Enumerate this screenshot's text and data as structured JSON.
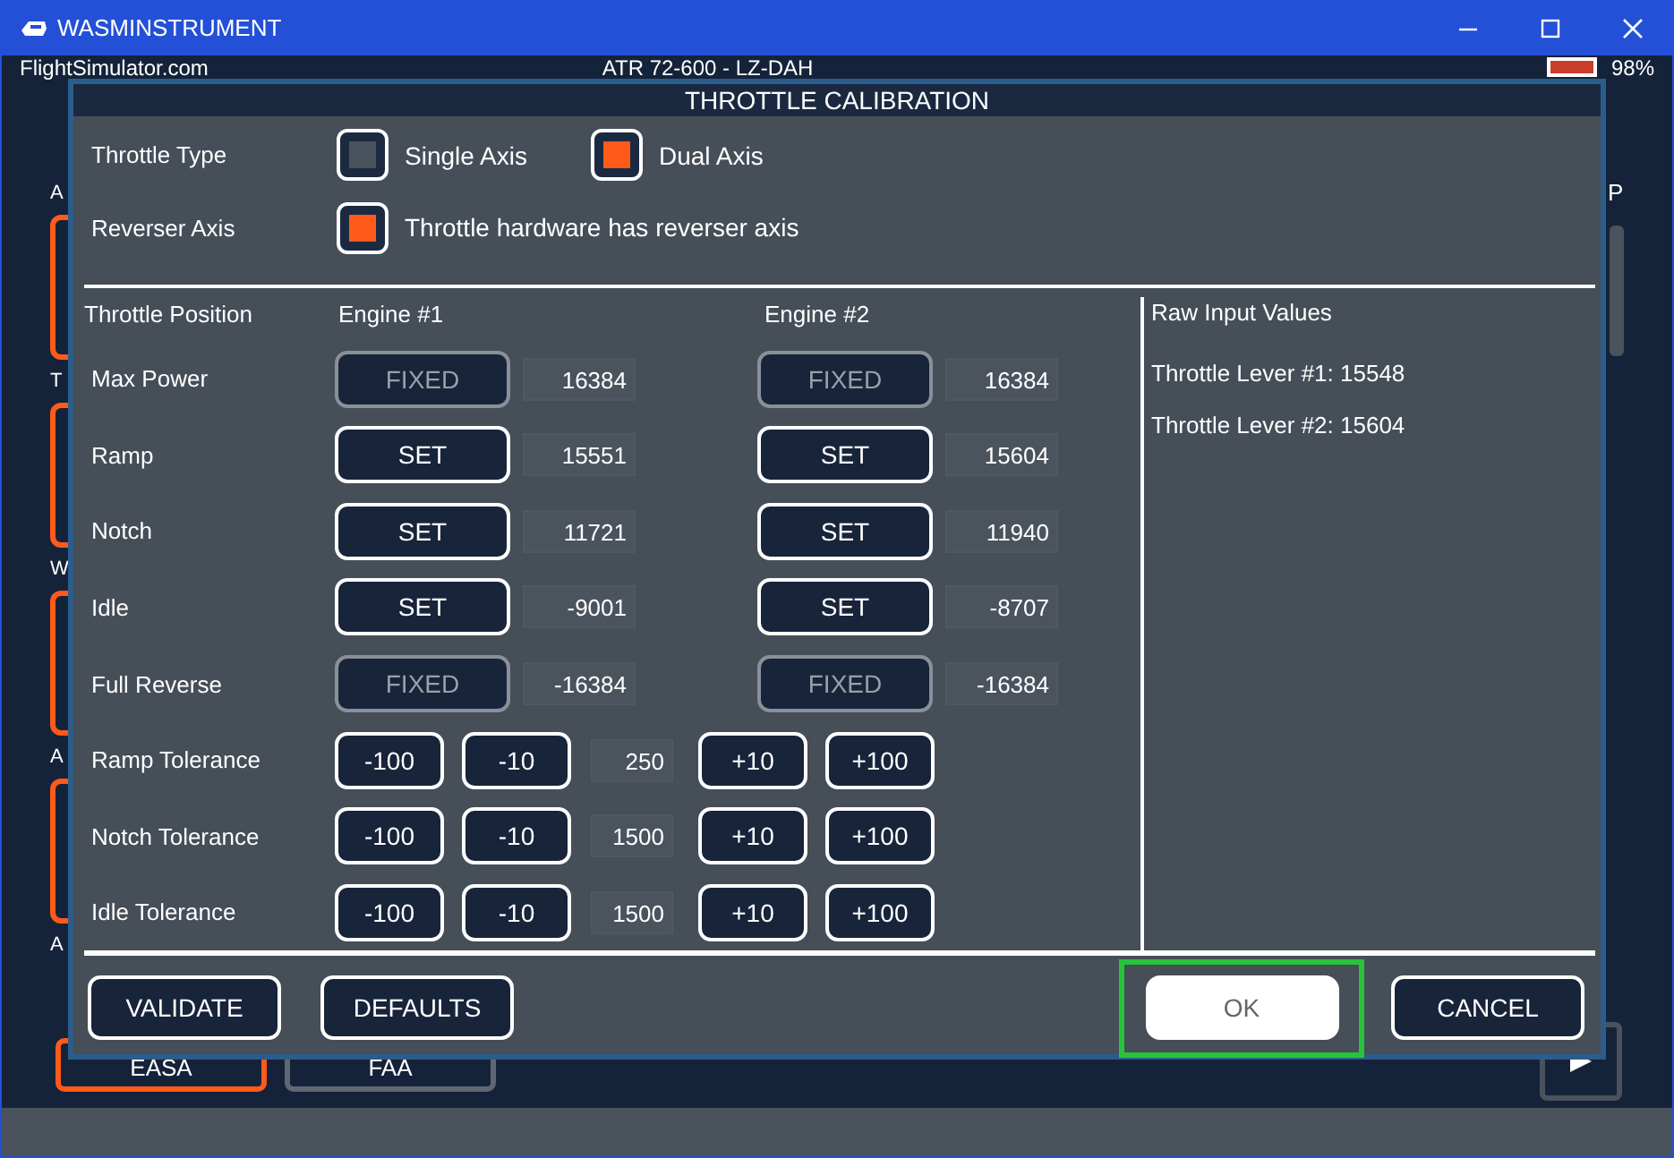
{
  "window": {
    "title": "WASMINSTRUMENT"
  },
  "app_header": {
    "site": "FlightSimulator.com",
    "aircraft": "ATR 72-600 - LZ-DAH",
    "battery": "98%"
  },
  "side_labels": [
    "A",
    "T",
    "W",
    "A",
    "A"
  ],
  "right_label": "P",
  "bottom_tabs": [
    {
      "label": "EASA",
      "selected": true
    },
    {
      "label": "FAA",
      "selected": false
    }
  ],
  "dialog": {
    "title": "THROTTLE CALIBRATION",
    "throttle_type": {
      "label": "Throttle Type",
      "options": [
        {
          "label": "Single Axis",
          "selected": false
        },
        {
          "label": "Dual Axis",
          "selected": true
        }
      ]
    },
    "reverser": {
      "label": "Reverser Axis",
      "text": "Throttle hardware has reverser axis",
      "checked": true
    },
    "columns": [
      "Throttle Position",
      "Engine #1",
      "Engine #2"
    ],
    "positions": [
      {
        "label": "Max Power",
        "engines": [
          {
            "button": "FIXED",
            "disabled": true,
            "value": "16384"
          },
          {
            "button": "FIXED",
            "disabled": true,
            "value": "16384"
          }
        ]
      },
      {
        "label": "Ramp",
        "engines": [
          {
            "button": "SET",
            "disabled": false,
            "value": "15551"
          },
          {
            "button": "SET",
            "disabled": false,
            "value": "15604"
          }
        ]
      },
      {
        "label": "Notch",
        "engines": [
          {
            "button": "SET",
            "disabled": false,
            "value": "11721"
          },
          {
            "button": "SET",
            "disabled": false,
            "value": "11940"
          }
        ]
      },
      {
        "label": "Idle",
        "engines": [
          {
            "button": "SET",
            "disabled": false,
            "value": "-9001"
          },
          {
            "button": "SET",
            "disabled": false,
            "value": "-8707"
          }
        ]
      },
      {
        "label": "Full Reverse",
        "engines": [
          {
            "button": "FIXED",
            "disabled": true,
            "value": "-16384"
          },
          {
            "button": "FIXED",
            "disabled": true,
            "value": "-16384"
          }
        ]
      }
    ],
    "tolerances": [
      {
        "label": "Ramp Tolerance",
        "minus": [
          "-100",
          "-10"
        ],
        "value": "250",
        "plus": [
          "+10",
          "+100"
        ]
      },
      {
        "label": "Notch Tolerance",
        "minus": [
          "-100",
          "-10"
        ],
        "value": "1500",
        "plus": [
          "+10",
          "+100"
        ]
      },
      {
        "label": "Idle Tolerance",
        "minus": [
          "-100",
          "-10"
        ],
        "value": "1500",
        "plus": [
          "+10",
          "+100"
        ]
      }
    ],
    "raw_input": {
      "title": "Raw Input Values",
      "lines": [
        "Throttle Lever #1: 15548",
        "Throttle Lever #2: 15604"
      ]
    },
    "buttons": [
      {
        "label": "VALIDATE",
        "focused": false,
        "kind": "left"
      },
      {
        "label": "DEFAULTS",
        "focused": false,
        "kind": "left"
      },
      {
        "label": "OK",
        "focused": true,
        "kind": "right"
      },
      {
        "label": "CANCEL",
        "focused": false,
        "kind": "right"
      }
    ]
  }
}
